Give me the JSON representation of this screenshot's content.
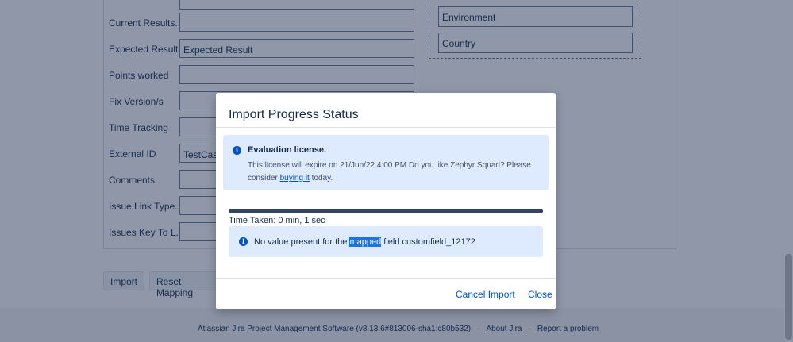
{
  "form": {
    "rows": [
      {
        "label": "Current Results...",
        "value": ""
      },
      {
        "label": "Expected Result...",
        "value": "Expected Result"
      },
      {
        "label": "Points worked",
        "value": ""
      },
      {
        "label": "Fix Version/s",
        "value": ""
      },
      {
        "label": "Time Tracking",
        "value": ""
      },
      {
        "label": "External ID",
        "value": "TestCase"
      },
      {
        "label": "Comments",
        "value": ""
      },
      {
        "label": "Issue Link Type...",
        "value": ""
      },
      {
        "label": "Issues Key To L...",
        "value": ""
      }
    ],
    "right_fields": [
      "Environment",
      "Country"
    ],
    "import_label": "Import",
    "reset_label": "Reset Mapping"
  },
  "modal": {
    "title": "Import Progress Status",
    "license": {
      "title": "Evaluation license.",
      "text_before": "This license will expire on 21/Jun/22 4:00 PM.Do you like Zephyr Squad? Please consider ",
      "link": "buying it",
      "text_after": " today."
    },
    "progress": 1.0,
    "time_taken": "Time Taken: 0 min, 1 sec",
    "message": {
      "before": "No value present for the ",
      "highlight": "mapped",
      "after": " field customfield_12172"
    },
    "cancel_label": "Cancel Import",
    "close_label": "Close"
  },
  "footer": {
    "prefix": "Atlassian Jira ",
    "pm_link": "Project Management Software",
    "version": " (v8.13.6#813006-sha1:c80b532)",
    "sep": "·",
    "about": "About Jira",
    "report": "Report a problem"
  },
  "colors": {
    "overlay": "#8f97a8",
    "accent": "#0052cc",
    "info_bg": "#deebff",
    "highlight": "#1a73e8"
  }
}
